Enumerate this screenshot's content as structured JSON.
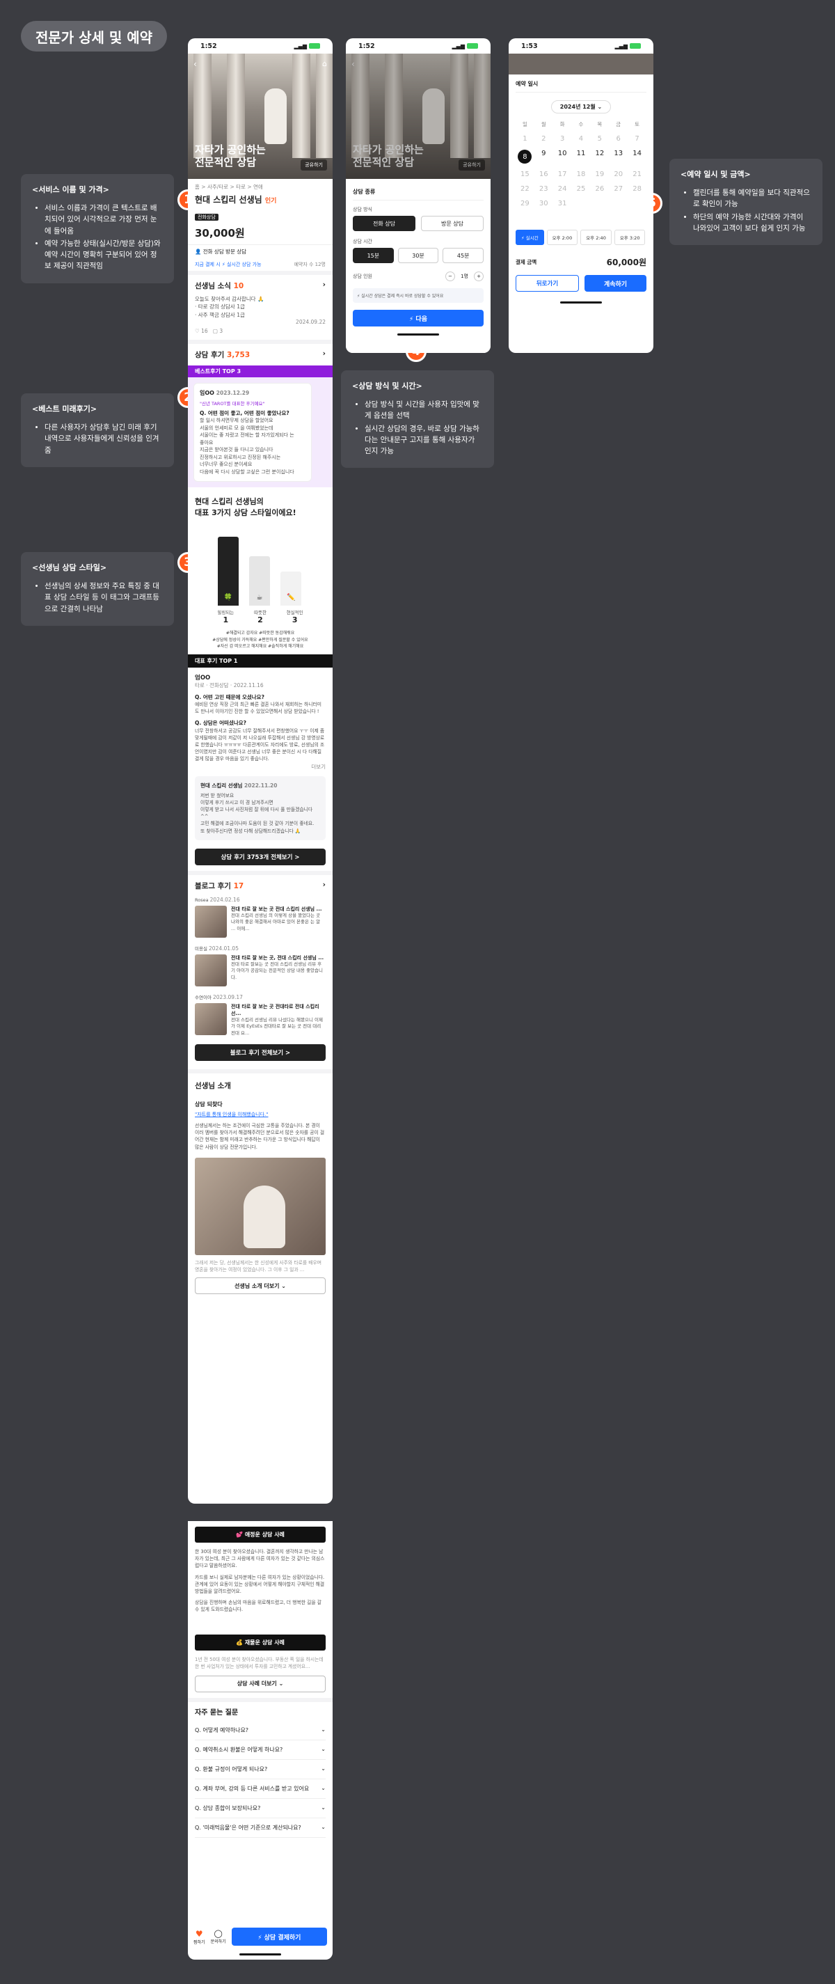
{
  "page": {
    "title": "전문가 상세 및 예약"
  },
  "notes": [
    {
      "num": "1",
      "title": "<서비스 이름 및 가격>",
      "items": [
        "서비스 이름과 가격이 큰 텍스트로 배치되어 있어 시각적으로 가장 먼저 눈에 들어옴",
        "예약 가능한 상태(실시간/방문 상담)와 예약 시간이 명확히 구분되어 있어 정보 제공이 직관적임"
      ]
    },
    {
      "num": "2",
      "title": "<베스트 미래후기>",
      "items": [
        "다른 사용자가 상담후 남긴 미래 후기 내역으로 사용자들에게 신뢰성을 인겨줌"
      ]
    },
    {
      "num": "3",
      "title": "<선생님 상담 스타일>",
      "items": [
        "선생님의 상세 정보와 주요 특징 중 대표 상담 스타일 등 이 태그와 그래프등으로 간결히 나타남"
      ]
    },
    {
      "num": "4",
      "title": "<상담 방식 및 시간>",
      "items": [
        "상담 방식 및 시간을 사용자 입맛에 맞게 옵션을 선택",
        "실시간 상담의 경우, 바로 상담 가능하다는 안내문구 고지를 통해 사용자가 인지 가능"
      ]
    },
    {
      "num": "5",
      "title": "<예약 일시 및 금액>",
      "items": [
        "캘린더를 통해 예약일을 보다 직관적으로 확인이 가능",
        "하단의 예약 가능한 시간대와 가격이 나와있어 고객이 보다 쉽게 인지 가능"
      ]
    }
  ],
  "colors": {
    "accent": "#ff5b1e",
    "blue": "#1a6cff",
    "bg": "#3b3c41"
  },
  "status": {
    "time": "1:52",
    "time2": "1:52",
    "time3": "1:53"
  },
  "detail": {
    "hero_title": "자타가 공인하는\n전문적인 상담",
    "hero_tag": "공유하기",
    "breadcrumb": "홈 > 사주/타로 > 타로 > 연애",
    "name": "현대 스킵리 선생님",
    "tag1": "인기",
    "tag2": "전화상담",
    "price": "30,000원",
    "svc": "전화 상담 방문 상담",
    "reserve": "지금 결제 시 ⚡ 실시간 상담 가능",
    "reserve2": "예약자 수 12명",
    "news_title": "선생님 소식",
    "news_count": "10",
    "news_text": "오늘도 찾아주셔 감사합니다 🙏",
    "news_sub1": "· 타로 강의 상담사 1급",
    "news_sub2": "· 사주 책금 상담사 1급",
    "news_date": "2024.09.22",
    "likes": "16",
    "comments": "3",
    "review_title": "상담 후기",
    "review_count": "3,753",
    "best_label": "베스트후기 TOP 3",
    "best_user": "임OO",
    "best_date": "2023.12.29",
    "best_chip": "\"신년 TAROT를 대표한 후기예요\"",
    "best_q": "Q. 어떤 점이 좋고, 어떤 점이 좋았나요?",
    "best_text": "할 일시 하셔면무제 상담을 할었어요\n서울의 언세미르 모 을 여쭤봤었는데\n서울이는 좋 자랐고 전에는 할 자가있게되다 는\n좋아요\n지금은 받아본것 들 다니고 있습니다\n진정하시고 위로하시고 진정된 해주시는\n너무너무 좋으신 분이세요\n다음에 꼭 다시 상담할 고싶은 그런 분이십니다",
    "style_title_1": "현대 스킵리 선생님의",
    "style_title_2": "대표 3가지 상담 스타일이에요!",
    "style_items": [
      {
        "label": "힐링되는",
        "rank": "1",
        "value": 0.9
      },
      {
        "label": "따뜻한",
        "rank": "2",
        "value": 0.65
      },
      {
        "label": "현실적인",
        "rank": "3",
        "value": 0.45
      }
    ],
    "style_tags": "#해결되고 감자요  #따뜻한 동감해줘요\n#상담에 정성이 가득해요  #편안하게 질문할 수 있어요\n#자신 감 떠오르고 해지해요  #솔직하게 해기해요",
    "top1_label": "대표 후기 TOP 1",
    "top1_user": "엄OO",
    "top1_meta": "타로 · 전화상담 · 2022.11.16",
    "top1_q1": "Q. 어떤 고민 때문에 오셨나요?",
    "top1_a1": "예비된 연상 직장 근의 최근 빠른 결혼 나와서 재회하는 하니터미도 만나서 이야기인 진한 할 수 있었으면해서 상담 받았습니다 !",
    "top1_q2": "Q. 상담은 어떠셨나요?",
    "top1_a2": "너무 전창하셔고 공감도 너무 잘해주셔서 편창했어요 ㅜㅜ 이제 좀 맞게될때에 감이 저같이 저 나오실래 투잡해서 선생님 강 방영상로로 한했습니다 ㅠㅠㅠㅠ 다른관계이도 자리에도 방료, 선생님의 조언이였지만 감이 여준다고 선생님 너무 좋은 분이신 시 다 다해질결게 많을 경우 마음을 있기 좋습니다.",
    "top1_more": "더보기",
    "reply_user": "현대 스킵리 선생님",
    "reply_date": "2022.11.20",
    "reply_text": "저번 받 쳤어보요\n이렇게 후기 쓰시고 이 경 남겨주시면\n이렇게 받고 나서 사진처럼 잘 뒤에 다시 풀 만들겠습니다 ^^\n고민 해결에 조금이나마 도움이 된 것 같아 기분이 좋네요.\n또 찾아주신다면 정성 다해 상담해드리겠습니다 🙏",
    "review_all_btn": "상담 후기 3753개 전체보기 >",
    "blog_title": "블로그 후기",
    "blog_count": "17",
    "blogs": [
      {
        "user": "Rosea",
        "date": "2024.02.16",
        "title": "전대 타로 잘 보는 곳 전대 스킵리 선생님 ...",
        "text": "전대 스킵리 선생님 의 이렇게 상을 봤었다는 곳 나와의 좋은 해결해서 아마로 있어 본좋은 는 알 ... 이에..."
      },
      {
        "user": "미용실",
        "date": "2024.01.05",
        "title": "전대 타로 잘 보는 곳, 전대 스킵리 선생님 ...",
        "text": "전대 타로 잘보는 곳 전대 스킵리 선생님 리뷰 후기 아이가 공감되는 전문적인 상담 내용 좋았습니다."
      },
      {
        "user": "수연이아",
        "date": "2023.09.17",
        "title": "전대 타로 잘 보는 곳 전대타로 전대 스킵리 선...",
        "text": "전대 스킵리 선생님 리뷰 나섰다는 해봤으니 이제 가 이제 EyEsEs 전대타로 잘 보는 곳 전대 대리 전대 요..."
      }
    ],
    "blog_all_btn": "블로그 후기 전체보기 >",
    "intro_title": "선생님 소개",
    "intro_sub": "상담 되찾다",
    "intro_link": "\"자트를 통해 인생을 이해했습니다.\"",
    "intro_text": "선생님께서는 하는 조건에이 극심한 고통을 주었습니다. 본 경이 이러 멤버를 찾아가서 해결해주려던 분으로서 많은 숫자를 공이 걸어간 현재는 함께 미래고 반추하는 다가운 그 방식입니다 해답이 많은 사람이 상담 전문가입니다.",
    "intro_text2": "그래서 저는 당, 선생님께서는 한 신성에게 사주와 타로를 배우며 영혼을 찾아가는 여정이 있었습니다. 그 이후 그 일과 ...",
    "intro_more_btn": "선생님 소개 더보기",
    "case1_title": "💕 애정운 상담 사례",
    "case1_text1": "한 30대 여성 분이 찾아오셨습니다. 결혼까지 생각하고 만나는 남자가 있는데, 최근 그 사람에게 다른 여자가 있는 것 같다는 의심스럽다고 말씀하셨어요.",
    "case1_text2": "카드를 보니 실제로 남자분께는 다른 여자가 있는 상황이었습니다. 관계에 있어 요동이 있는 상황에서 어떻게 해야할지 구체적인 해결방법들을 알려드렸어요.",
    "case1_text3": "상담을 진행하며 손님의 마음을 위로해드렸고, 더 행복한 길을 갈 수 있게 도와드렸습니다.",
    "case2_title": "💰 재물운 상담 사례",
    "case2_text": "1년 전 50대 여성 분이 찾아오셨습니다. 부동산 쪽 일을 하시는데 한 번 사업처가 있는 상태에서 투자를 고민하고 계셨어요...",
    "case_more_btn": "상담 사례 더보기",
    "faq_title": "자주 묻는 질문",
    "faqs": [
      "Q. 어떻게 예약하나요?",
      "Q. 예약취소시 환불은 어떻게 하나요?",
      "Q. 환불 규정이 어떻게 되나요?",
      "Q. 계좌 부여, 강의 등 다른 서비스를 받고 있어요",
      "Q. 상담 종합이 보장되나요?",
      "Q. '미래먹음물'은 어떤 기준으로 계산되나요?"
    ],
    "bottom_like": "찜하기",
    "bottom_chat": "문의하기",
    "bottom_btn": "⚡ 상담 결제하기"
  },
  "option": {
    "header": "상담 종류",
    "method_label": "상담 방식",
    "method_opts": [
      "전화 상담",
      "방문 상담"
    ],
    "time_label": "상담 시간",
    "time_opts": [
      "15분",
      "30분",
      "45분"
    ],
    "count_label": "상담 인원",
    "count": "1명",
    "notice": "⚡ 실시간 상담은 결제 즉시 바로 상담할 수 있어요",
    "next_btn": "⚡ 다음"
  },
  "calendar": {
    "title": "예약 일시",
    "month": "2024년 12월",
    "weekdays": [
      "일",
      "월",
      "화",
      "수",
      "목",
      "금",
      "토"
    ],
    "rows": [
      [
        "1",
        "2",
        "3",
        "4",
        "5",
        "6",
        "7"
      ],
      [
        "8",
        "9",
        "10",
        "11",
        "12",
        "13",
        "14"
      ],
      [
        "15",
        "16",
        "17",
        "18",
        "19",
        "20",
        "21"
      ],
      [
        "22",
        "23",
        "24",
        "25",
        "26",
        "27",
        "28"
      ],
      [
        "29",
        "30",
        "31",
        "",
        "",
        "",
        ""
      ]
    ],
    "selected": "8",
    "slots": [
      "⚡ 실시간",
      "오후 2:00",
      "오후 2:40",
      "오후 3:20"
    ],
    "total_label": "결제 금액",
    "total": "60,000원",
    "back_btn": "뒤로가기",
    "next_btn": "계속하기"
  }
}
